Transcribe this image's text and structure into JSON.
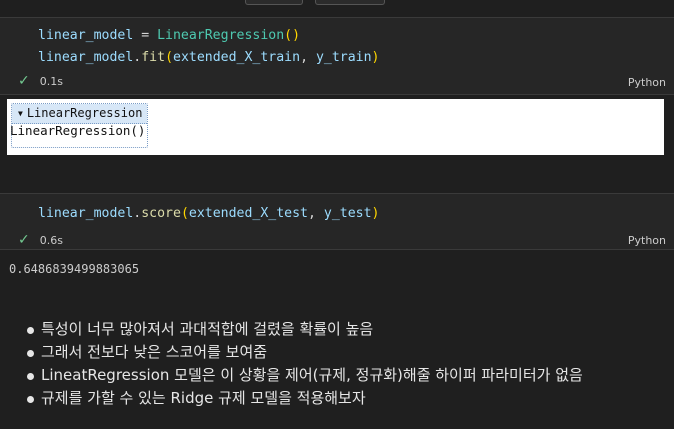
{
  "cell1": {
    "lines": [
      [
        {
          "t": "linear_model",
          "c": "var"
        },
        {
          "t": " = ",
          "c": "op"
        },
        {
          "t": "LinearRegression",
          "c": "cls"
        },
        {
          "t": "()",
          "c": "par"
        }
      ],
      [
        {
          "t": "linear_model",
          "c": "var"
        },
        {
          "t": ".",
          "c": "op"
        },
        {
          "t": "fit",
          "c": "fn"
        },
        {
          "t": "(",
          "c": "par"
        },
        {
          "t": "extended_X_train",
          "c": "var"
        },
        {
          "t": ", ",
          "c": "op"
        },
        {
          "t": "y_train",
          "c": "var"
        },
        {
          "t": ")",
          "c": "par"
        }
      ]
    ],
    "time": "0.1s",
    "lang": "Python"
  },
  "output1": {
    "estimator_header": "LinearRegression",
    "estimator_body": "LinearRegression()"
  },
  "cell2": {
    "lines": [
      [
        {
          "t": "linear_model",
          "c": "var"
        },
        {
          "t": ".",
          "c": "op"
        },
        {
          "t": "score",
          "c": "fn"
        },
        {
          "t": "(",
          "c": "par"
        },
        {
          "t": "extended_X_test",
          "c": "var"
        },
        {
          "t": ", ",
          "c": "op"
        },
        {
          "t": "y_test",
          "c": "var"
        },
        {
          "t": ")",
          "c": "par"
        }
      ]
    ],
    "time": "0.6s",
    "lang": "Python"
  },
  "output2": {
    "value": "0.6486839499883065"
  },
  "markdown": {
    "bullets": [
      "특성이 너무 많아져서 과대적합에 걸렸을 확률이 높음",
      "그래서 전보다 낮은 스코어를 보여줌",
      "LineatRegression 모델은 이 상황을 제어(규제, 정규화)해줄 하이퍼 파라미터가 없음",
      "규제를 가할 수 있는 Ridge 규제 모델을 적용해보자"
    ]
  },
  "icons": {
    "check": "check-icon",
    "collapse": "triangle-down-icon"
  },
  "colors": {
    "check": "#73c991",
    "estimator_header_bg": "#d7e7f7"
  }
}
